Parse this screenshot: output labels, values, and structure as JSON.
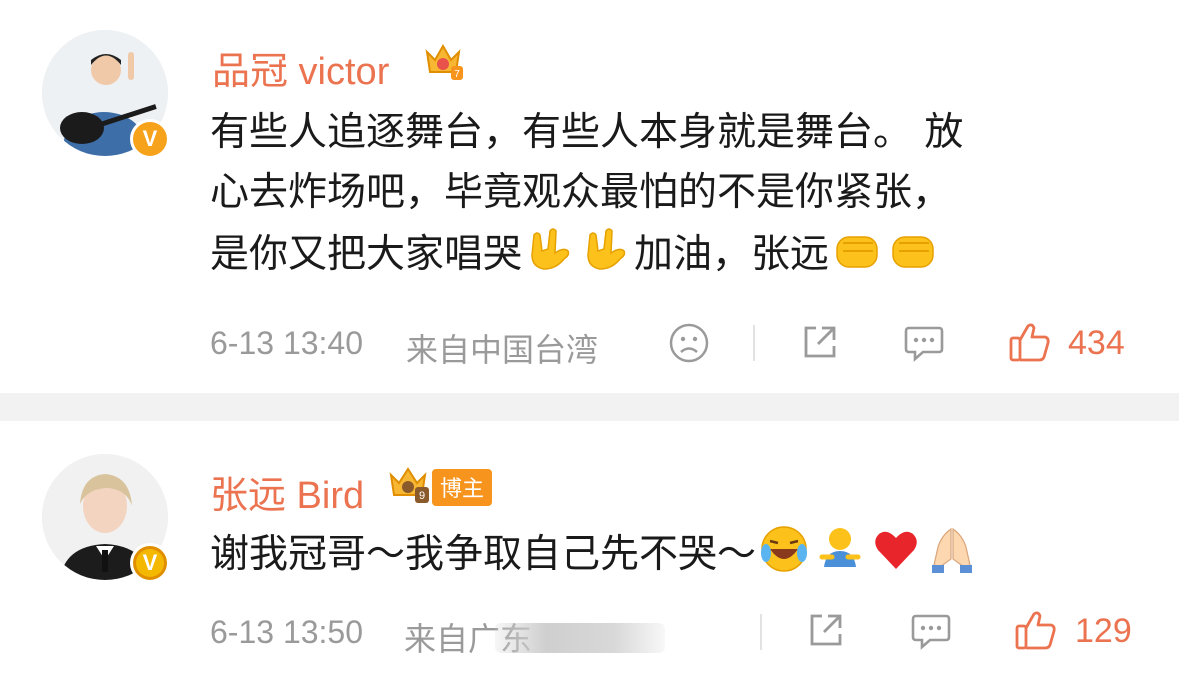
{
  "comments": [
    {
      "username": "品冠 victor",
      "crown_level": "7",
      "verified_badge": "V",
      "lines": [
        "有些人追逐舞台，有些人本身就是舞台。 放",
        "心去炸场吧，毕竟观众最怕的不是你紧张，",
        "是你又把大家唱哭"
      ],
      "line3_mid": "加油，张远",
      "emojis": [
        "rock-on-hand",
        "rock-on-hand",
        "fist",
        "fist"
      ],
      "time": "6-13 13:40",
      "source": "来自中国台湾",
      "likes": "434"
    },
    {
      "username": "张远 Bird",
      "crown_level": "9",
      "verified_badge": "V",
      "author_tag": "博主",
      "text": "谢我冠哥～我争取自己先不哭～",
      "emojis": [
        "laughing-crying",
        "hugging-figure",
        "red-heart",
        "praying-hands"
      ],
      "time": "6-13 13:50",
      "source": "来自广东",
      "likes": "129"
    }
  ],
  "colors": {
    "username": "#eb7350",
    "meta": "#9a9a9a",
    "like": "#eb7350",
    "divider": "#f2f2f2"
  }
}
